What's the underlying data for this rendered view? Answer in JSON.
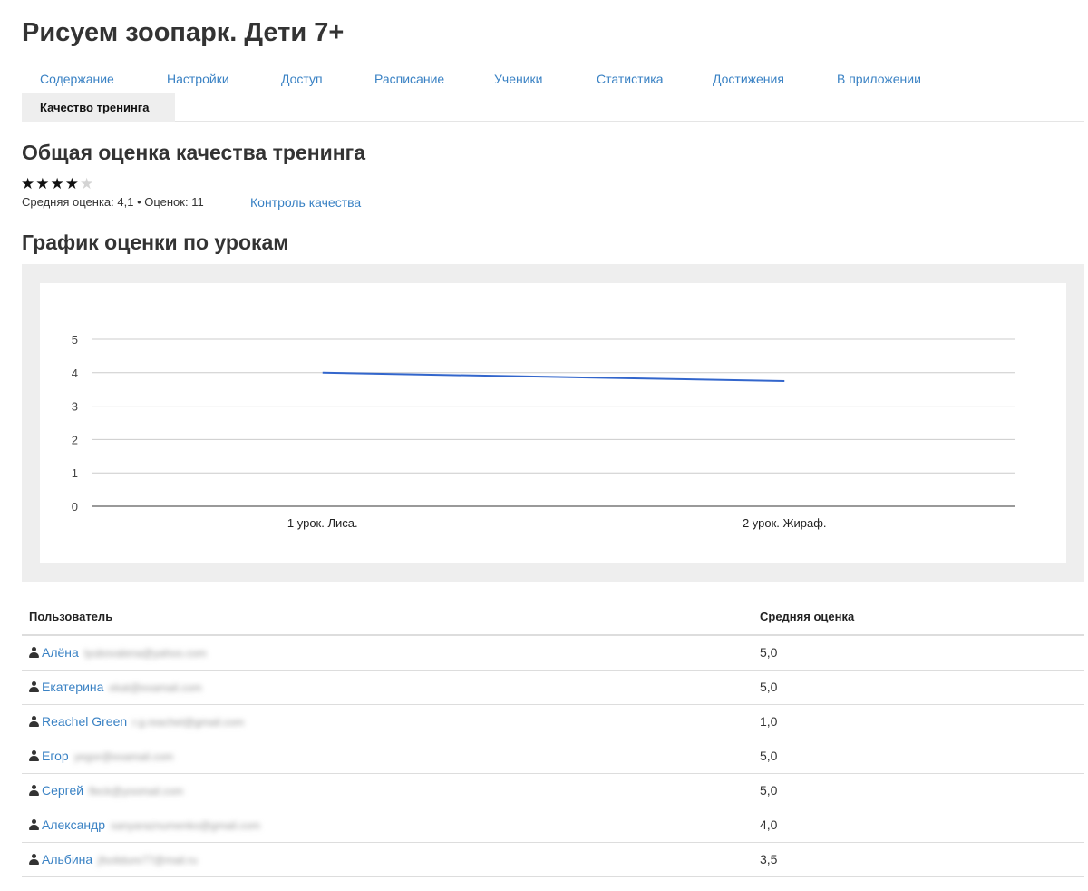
{
  "page": {
    "title": "Рисуем зоопарк. Дети 7+"
  },
  "tabs": [
    {
      "label": "Содержание"
    },
    {
      "label": "Настройки"
    },
    {
      "label": "Доступ"
    },
    {
      "label": "Расписание"
    },
    {
      "label": "Ученики"
    },
    {
      "label": "Статистика"
    },
    {
      "label": "Достижения"
    },
    {
      "label": "В приложении"
    },
    {
      "label": "Качество тренинга",
      "active": true
    }
  ],
  "quality": {
    "heading": "Общая оценка качества тренинга",
    "stars_filled": 4,
    "stars_total": 5,
    "summary": "Средняя оценка: 4,1 • Оценок: 11",
    "control_link": "Контроль качества"
  },
  "lesson_chart": {
    "heading": "График оценки по урокам"
  },
  "chart_data": {
    "type": "line",
    "title": "",
    "xlabel": "",
    "ylabel": "",
    "categories": [
      "1 урок. Лиса.",
      "2 урок. Жираф."
    ],
    "series": [
      {
        "values": [
          4.0,
          3.75
        ],
        "color": "#3366cc"
      }
    ],
    "ylim": [
      0,
      5
    ],
    "yticks": [
      0,
      1,
      2,
      3,
      4,
      5
    ],
    "grid": true,
    "legend": "none"
  },
  "table": {
    "columns": [
      "Пользователь",
      "Средняя оценка"
    ],
    "rows": [
      {
        "name": "Алёна",
        "email": "lyubovalena@yahoo.com",
        "avg": "5,0"
      },
      {
        "name": "Екатерина",
        "email": "ekat@examail.com",
        "avg": "5,0"
      },
      {
        "name": "Reachel Green",
        "email": "r.g.reachel@gmail.com",
        "avg": "1,0"
      },
      {
        "name": "Егор",
        "email": "yegor@examail.com",
        "avg": "5,0"
      },
      {
        "name": "Сергей",
        "email": "fleck@yoomail.com",
        "avg": "5,0"
      },
      {
        "name": "Александр",
        "email": "sanyaraznumenko@gmail.com",
        "avg": "4,0"
      },
      {
        "name": "Альбина",
        "email": "jfsolidure77@mail.ru",
        "avg": "3,5"
      }
    ]
  },
  "colors": {
    "link": "#3a82c4",
    "chart_line": "#3366cc",
    "panel_bg": "#eeeeee"
  }
}
